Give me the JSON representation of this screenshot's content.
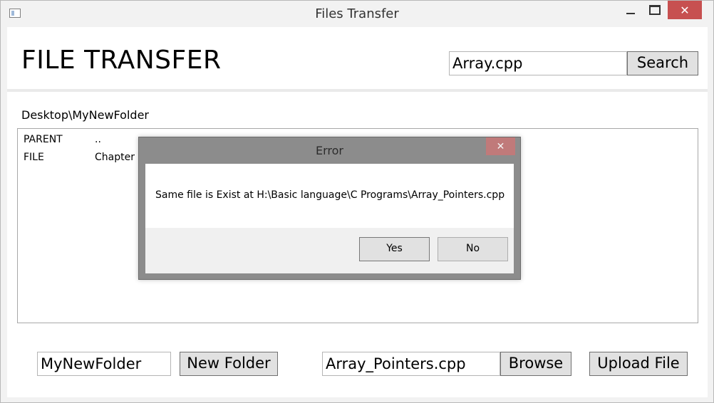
{
  "window": {
    "title": "Files Transfer",
    "minimize_icon": "minimize-icon",
    "maximize_icon": "maximize-icon",
    "close_glyph": "✕"
  },
  "header": {
    "heading": "FILE TRANSFER",
    "search_value": "Array.cpp",
    "search_button": "Search"
  },
  "breadcrumb": "Desktop\\MyNewFolder",
  "file_list": {
    "rows": [
      {
        "type": "PARENT",
        "name": ".."
      },
      {
        "type": "FILE",
        "name": "Chapter 4"
      }
    ]
  },
  "footer": {
    "folder_name_value": "MyNewFolder",
    "new_folder_button": "New Folder",
    "upload_path_value": "Array_Pointers.cpp",
    "browse_button": "Browse",
    "upload_button": "Upload File"
  },
  "dialog": {
    "title": "Error",
    "close_glyph": "✕",
    "message": "Same file is Exist at H:\\Basic language\\C Programs\\Array_Pointers.cpp",
    "yes_button": "Yes",
    "no_button": "No"
  },
  "colors": {
    "close_button": "#c75050",
    "dialog_frame": "#8c8c8c",
    "button_face": "#e1e1e1"
  }
}
